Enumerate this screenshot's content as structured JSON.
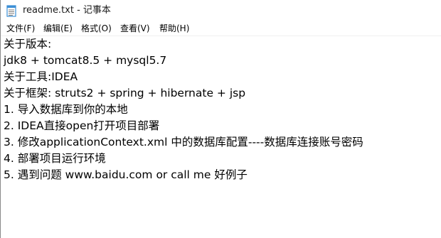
{
  "window": {
    "title": "readme.txt - 记事本"
  },
  "menubar": {
    "items": [
      {
        "label": "文件(F)"
      },
      {
        "label": "编辑(E)"
      },
      {
        "label": "格式(O)"
      },
      {
        "label": "查看(V)"
      },
      {
        "label": "帮助(H)"
      }
    ]
  },
  "editor": {
    "lines": [
      "关于版本:",
      "jdk8 + tomcat8.5 + mysql5.7",
      "关于工具:IDEA",
      "关于框架: struts2 + spring + hibernate + jsp",
      "1. 导入数据库到你的本地",
      "2. IDEA直接open打开项目部署",
      "3. 修改applicationContext.xml 中的数据库配置----数据库连接账号密码",
      "4. 部署项目运行环境",
      "5. 遇到问题 www.baidu.com or call me 好例子"
    ]
  },
  "icons": {
    "app": "notepad-icon"
  },
  "colors": {
    "text": "#000000",
    "background": "#ffffff",
    "icon_accent": "#3c8fd6"
  }
}
